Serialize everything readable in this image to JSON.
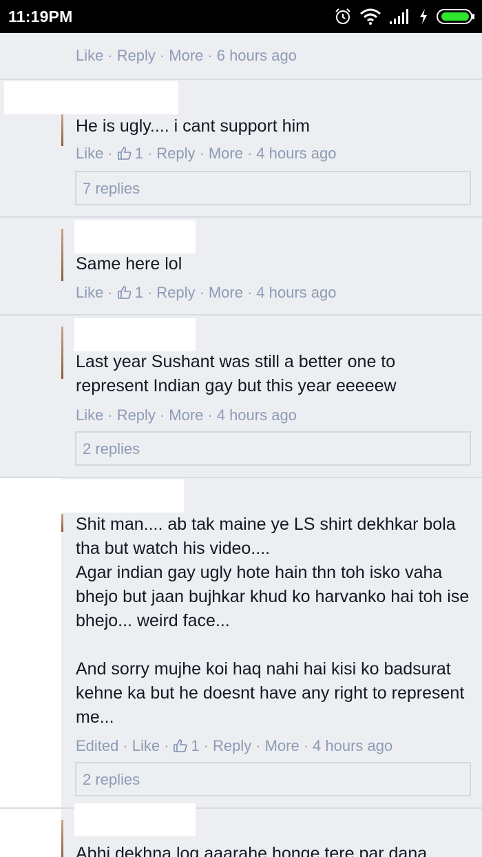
{
  "status_bar": {
    "time": "11:19PM"
  },
  "labels": {
    "like": "Like",
    "reply": "Reply",
    "more": "More",
    "edited": "Edited",
    "separator": "·"
  },
  "comments": [
    {
      "text": "",
      "likes": "",
      "age": "6 hours ago"
    },
    {
      "text": "He is ugly.... i cant support him",
      "likes": "1",
      "age": "4 hours ago",
      "replies": "7 replies"
    },
    {
      "text": "Same here lol",
      "likes": "1",
      "age": "4 hours ago"
    },
    {
      "text": "Last year Sushant was still a better one to represent Indian gay but this year eeeeew",
      "likes": "",
      "age": "4 hours ago",
      "replies": "2 replies"
    },
    {
      "text": "Shit man.... ab tak maine ye LS shirt dekhkar bola tha but watch his video....\nAgar indian gay ugly hote hain thn toh isko vaha bhejo but jaan bujhkar khud ko harvanko hai toh ise bhejo... weird face...\n\nAnd sorry mujhe koi haq nahi hai kisi ko badsurat kehne ka but he doesnt have any right to represent me...",
      "likes": "1",
      "age": "4 hours ago",
      "replies": "2 replies"
    },
    {
      "text": "Abhi dekhna log aaarahe honge tere par dana"
    }
  ],
  "icon_names": [
    "alarm-icon",
    "wifi-icon",
    "signal-icon",
    "charging-icon",
    "battery-icon",
    "thumbs-up-icon"
  ],
  "colors": {
    "meta_text": "#8d9bb5",
    "body_text": "#141823",
    "background": "#eceef1"
  }
}
